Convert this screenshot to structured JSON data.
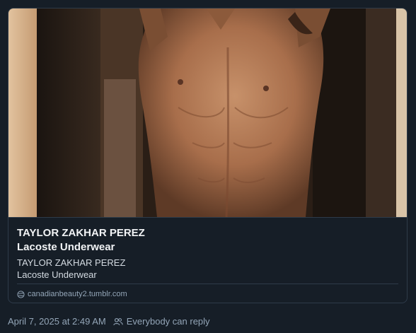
{
  "embed": {
    "title_line1": "TAYLOR ZAKHAR PEREZ",
    "title_line2": "Lacoste Underwear",
    "desc_line1": "TAYLOR ZAKHAR PEREZ",
    "desc_line2": "Lacoste Underwear",
    "domain": "canadianbeauty2.tumblr.com",
    "domain_icon": "globe-icon"
  },
  "post": {
    "timestamp": "April 7, 2025 at 2:49 AM",
    "reply_setting": "Everybody can reply",
    "reply_icon": "people-icon"
  },
  "colors": {
    "background": "#161e27",
    "border": "#2e3b49",
    "muted_text": "#93a5b7"
  }
}
